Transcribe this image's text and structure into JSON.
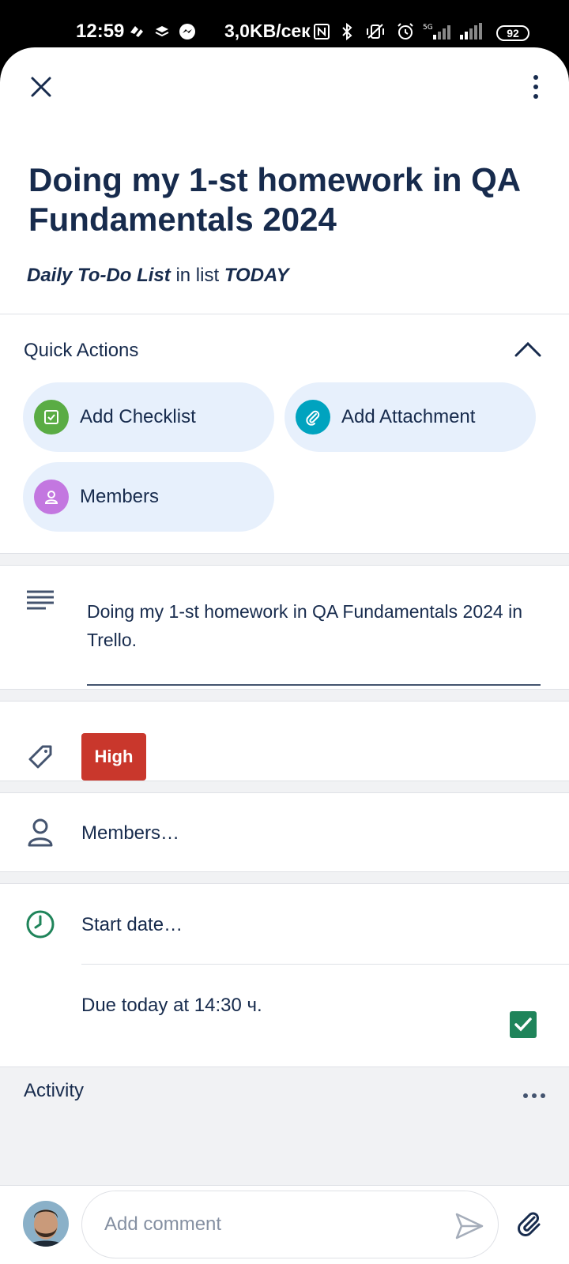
{
  "status_bar": {
    "time": "12:59",
    "network_speed": "3,0KB/сек",
    "battery": "92",
    "signal_label": "5G"
  },
  "card": {
    "title": "Doing my 1-st homework in QA Fundamentals 2024",
    "board": "Daily To-Do List",
    "in_list_text": "in list",
    "list": "TODAY"
  },
  "quick_actions": {
    "title": "Quick Actions",
    "add_checklist": "Add Checklist",
    "add_attachment": "Add Attachment",
    "members": "Members"
  },
  "description": {
    "text": "Doing my 1-st homework in QA Fundamentals 2024 in Trello."
  },
  "labels": {
    "items": [
      {
        "text": "High",
        "color": "#c9372c"
      }
    ]
  },
  "members_row": {
    "text": "Members…"
  },
  "dates": {
    "start": "Start date…",
    "due": "Due today at 14:30 ч.",
    "due_complete": true
  },
  "activity": {
    "title": "Activity"
  },
  "composer": {
    "placeholder": "Add comment"
  },
  "colors": {
    "text_primary": "#172b4d",
    "quick_action_bg": "#e7f0fc",
    "checklist_icon": "#5aac44",
    "attachment_icon": "#00a3bf",
    "members_icon": "#c377e0",
    "due_check": "#1f845a",
    "label_high": "#c9372c"
  },
  "icons": {
    "close": "close-icon",
    "more": "more-vertical-icon",
    "collapse": "chevron-up-icon",
    "description": "description-lines-icon",
    "label": "tag-icon",
    "members": "person-icon",
    "clock": "clock-icon",
    "send": "send-icon",
    "attach": "paperclip-icon"
  }
}
